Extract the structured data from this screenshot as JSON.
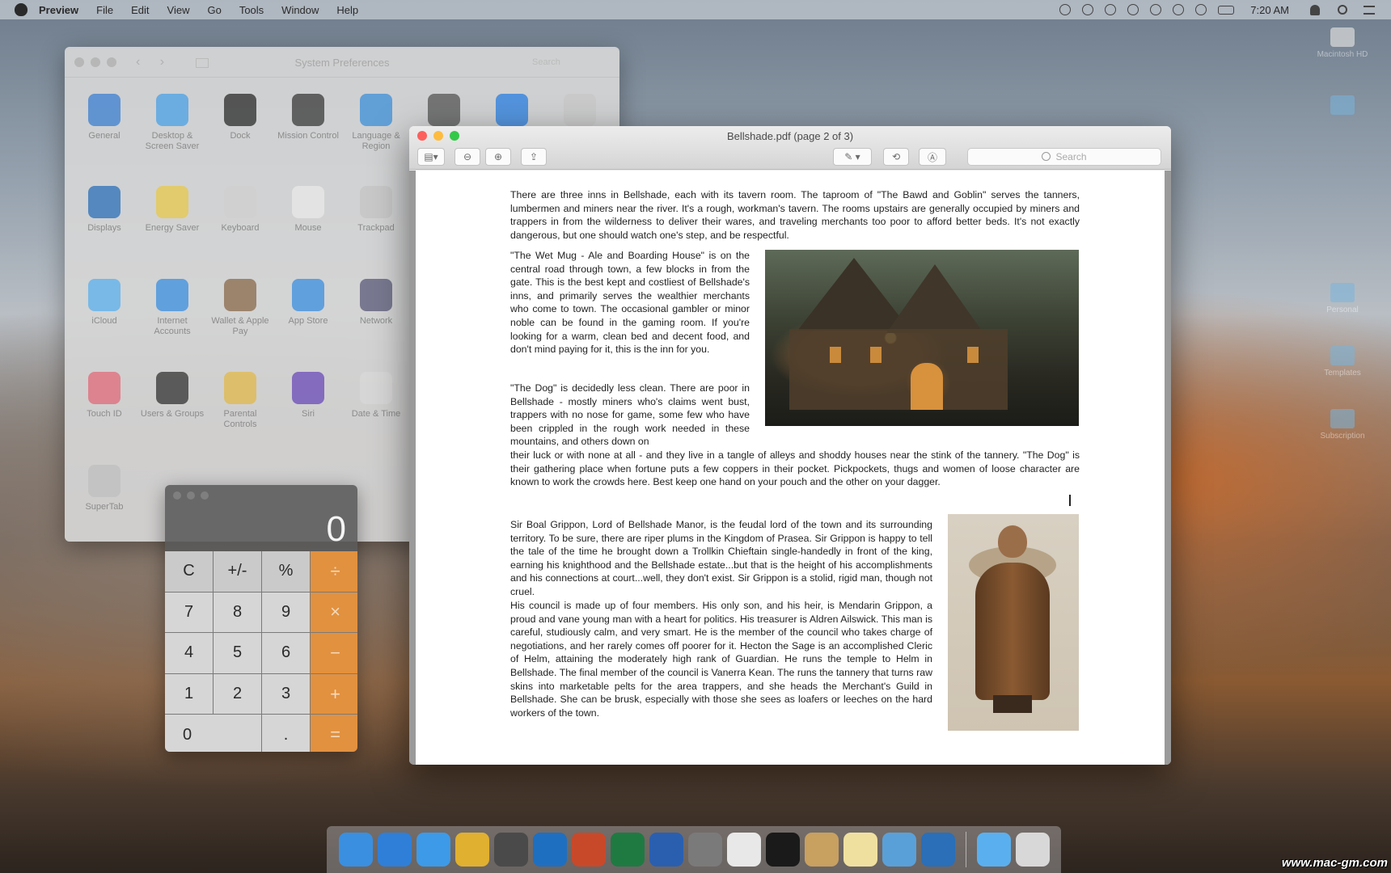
{
  "menubar": {
    "app_name": "Preview",
    "items": [
      "File",
      "Edit",
      "View",
      "Go",
      "Tools",
      "Window",
      "Help"
    ],
    "clock": "7:20 AM"
  },
  "desktop_icons": [
    {
      "label": "Macintosh HD"
    },
    {
      "label": ""
    },
    {
      "label": "Personal"
    },
    {
      "label": "Templates"
    },
    {
      "label": "Subscription"
    }
  ],
  "sysprefs": {
    "title": "System Preferences",
    "search_placeholder": "Search",
    "icons": [
      {
        "label": "General",
        "color": "#3b7fd0"
      },
      {
        "label": "Desktop & Screen Saver",
        "color": "#4aa0e6"
      },
      {
        "label": "Dock",
        "color": "#2b2b2b"
      },
      {
        "label": "Mission Control",
        "color": "#3a3a3a"
      },
      {
        "label": "Language & Region",
        "color": "#3c8fd8"
      },
      {
        "label": "",
        "color": "#555555"
      },
      {
        "label": "",
        "color": "#2a7fe0"
      },
      {
        "label": "",
        "color": "#c8c8c8"
      },
      {
        "label": "Displays",
        "color": "#2a6fb8"
      },
      {
        "label": "Energy Saver",
        "color": "#e6c84a"
      },
      {
        "label": "Keyboard",
        "color": "#cfcfcf"
      },
      {
        "label": "Mouse",
        "color": "#e8e8e8"
      },
      {
        "label": "Trackpad",
        "color": "#c4c4c4"
      },
      {
        "label": "iCloud",
        "color": "#5ab0ee"
      },
      {
        "label": "Internet Accounts",
        "color": "#3a8fe0"
      },
      {
        "label": "Wallet & Apple Pay",
        "color": "#8a6a4a"
      },
      {
        "label": "App Store",
        "color": "#3a8fe0"
      },
      {
        "label": "Network",
        "color": "#5a5a7a"
      },
      {
        "label": "Touch ID",
        "color": "#e06a7a"
      },
      {
        "label": "Users & Groups",
        "color": "#333333"
      },
      {
        "label": "Parental Controls",
        "color": "#e0b84a"
      },
      {
        "label": "Siri",
        "color": "#6a4ab8"
      },
      {
        "label": "Date & Time",
        "color": "#d8d8d8"
      },
      {
        "label": "SuperTab",
        "color": "#bfbfbf"
      }
    ]
  },
  "calculator": {
    "display": "0",
    "keys": [
      {
        "label": "C",
        "kind": "fn"
      },
      {
        "label": "+/-",
        "kind": "fn"
      },
      {
        "label": "%",
        "kind": "fn"
      },
      {
        "label": "÷",
        "kind": "op"
      },
      {
        "label": "7",
        "kind": "num"
      },
      {
        "label": "8",
        "kind": "num"
      },
      {
        "label": "9",
        "kind": "num"
      },
      {
        "label": "×",
        "kind": "op"
      },
      {
        "label": "4",
        "kind": "num"
      },
      {
        "label": "5",
        "kind": "num"
      },
      {
        "label": "6",
        "kind": "num"
      },
      {
        "label": "−",
        "kind": "op"
      },
      {
        "label": "1",
        "kind": "num"
      },
      {
        "label": "2",
        "kind": "num"
      },
      {
        "label": "3",
        "kind": "num"
      },
      {
        "label": "+",
        "kind": "op"
      },
      {
        "label": "0",
        "kind": "zero"
      },
      {
        "label": ".",
        "kind": "num"
      },
      {
        "label": "=",
        "kind": "op"
      }
    ]
  },
  "preview": {
    "title": "Bellshade.pdf (page 2 of 3)",
    "search_placeholder": "Search",
    "paragraphs": {
      "p1": "There are three inns in Bellshade, each with its tavern room.  The taproom of \"The Bawd and Goblin\" serves the tanners, lumbermen and miners near the river.  It's a rough, workman's tavern.  The rooms upstairs are generally occupied by miners and trappers in from the wilderness to deliver their wares, and traveling merchants too poor to afford better beds.  It's not exactly dangerous, but one should watch one's step, and be respectful.",
      "p2": "\"The Wet Mug - Ale and Boarding House\" is on the central road through town, a few blocks in from the gate.  This is the best kept and costliest of Bellshade's inns, and primarily serves the wealthier merchants who come to town. The occasional gambler or minor noble can be found in the gaming room.  If you're looking for a warm, clean bed and decent food, and don't mind paying for it, this is the inn for you.",
      "p3a": "\"The Dog\" is decidedly less clean.  There are poor in Bellshade - mostly miners who's claims went bust, trappers with no nose for game, some few who have been crippled in the rough work needed in these mountains, and others down on",
      "p3b": "their luck or with none at all - and they live in a tangle of alleys and shoddy houses near the stink of the tannery.  \"The Dog\" is their gathering place when fortune puts a few coppers in their pocket.  Pickpockets, thugs and women of loose character are known to work the crowds here.  Best keep one hand on your pouch and the other on your dagger.",
      "p4": "Sir Boal Grippon, Lord of Bellshade Manor, is the feudal lord of the town and its surrounding territory.  To be sure, there are riper plums in the Kingdom of Prasea.  Sir Grippon is happy to tell the tale of the time he brought down a Trollkin Chieftain single-handedly in front of the king, earning his knighthood and the Bellshade estate...but that is the height of his accomplishments and his connections at court...well, they don't exist.  Sir Grippon is a stolid, rigid man, though not cruel.",
      "p5": "His council is made up of four members.  His only son, and his heir, is Mendarin Grippon, a proud and vane young man with a heart for politics. His treasurer is Aldren Ailswick.  This man is careful, studiously calm, and very smart.  He is the member of the council who takes charge of negotiations, and her rarely comes off poorer for it.  Hecton the Sage is an accomplished Cleric of Helm, attaining the moderately high rank of Guardian.  He runs the temple to Helm in Bellshade. The final member of the council is Vanerra Kean.  The runs the tannery that turns raw skins into marketable pelts for the area trappers, and she heads the Merchant's Guild in Bellshade.  She can be brusk, especially with those she sees as loafers or leeches on the hard workers of the town."
    }
  },
  "dock": {
    "apps": [
      {
        "name": "finder-icon",
        "color": "#3a8fe0"
      },
      {
        "name": "app-store-icon",
        "color": "#2f7fd8"
      },
      {
        "name": "safari-icon",
        "color": "#3d9ae8"
      },
      {
        "name": "chrome-icon",
        "color": "#e0b030"
      },
      {
        "name": "sublime-icon",
        "color": "#4a4a4a"
      },
      {
        "name": "outlook-icon",
        "color": "#1f6fc0"
      },
      {
        "name": "powerpoint-icon",
        "color": "#c8492a"
      },
      {
        "name": "excel-icon",
        "color": "#1f7a42"
      },
      {
        "name": "word-icon",
        "color": "#2a5fb0"
      },
      {
        "name": "system-preferences-icon",
        "color": "#7a7a7a"
      },
      {
        "name": "textedit-icon",
        "color": "#e8e8e8"
      },
      {
        "name": "terminal-icon",
        "color": "#1a1a1a"
      },
      {
        "name": "preview-icon",
        "color": "#c8a060"
      },
      {
        "name": "notes-icon",
        "color": "#f0e0a0"
      },
      {
        "name": "photos-icon",
        "color": "#5aa0d8"
      },
      {
        "name": "quicktime-icon",
        "color": "#2a6fb8"
      }
    ],
    "trailing": [
      {
        "name": "downloads-folder-icon",
        "color": "#5ab0ee"
      },
      {
        "name": "trash-icon",
        "color": "#d8d8d8"
      }
    ]
  },
  "watermark": "www.mac-gm.com"
}
